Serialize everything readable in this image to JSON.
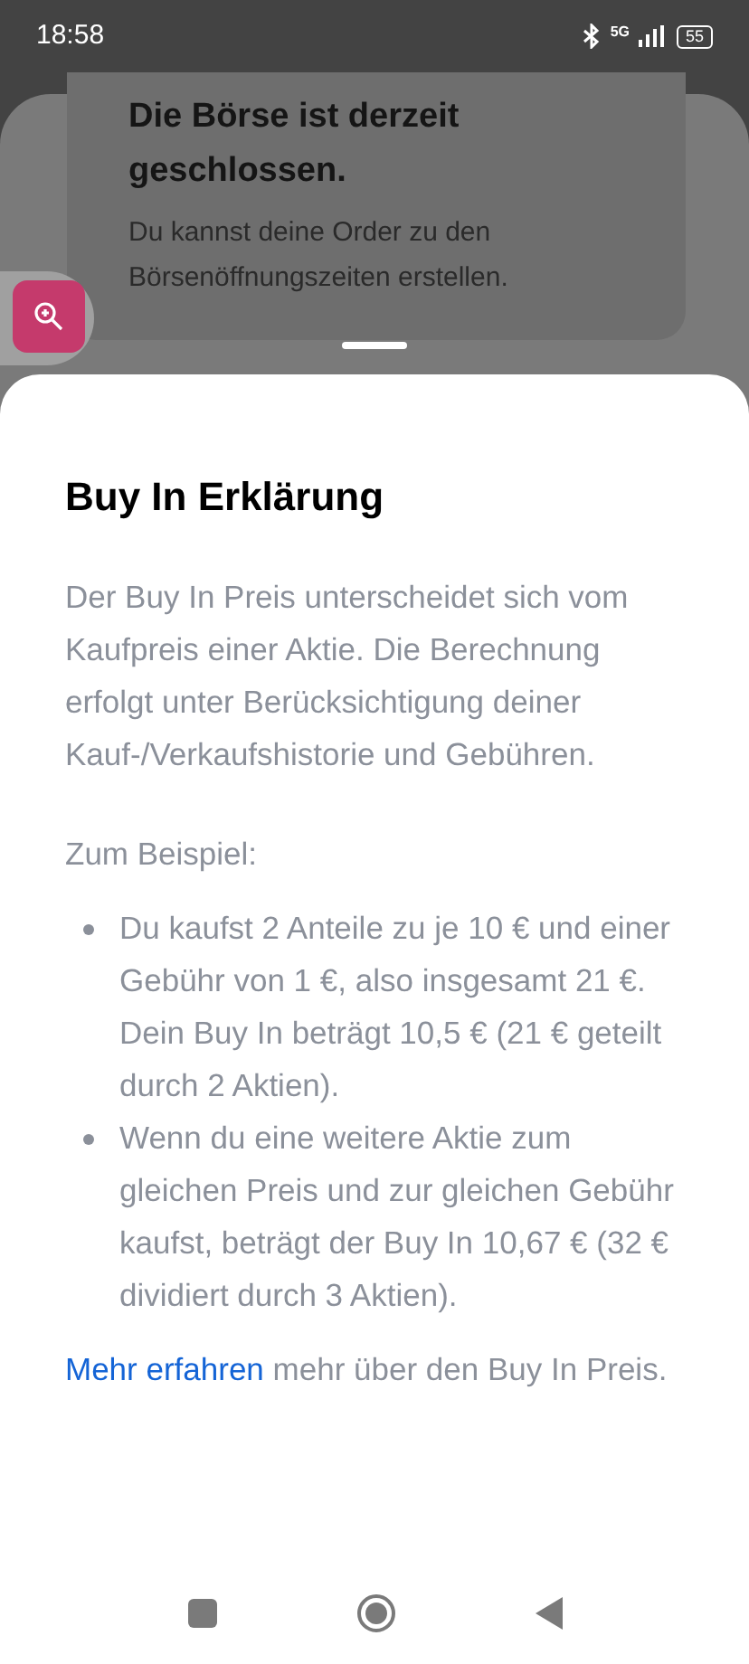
{
  "status_bar": {
    "time": "18:58",
    "network": "5G",
    "battery": "55"
  },
  "background_card": {
    "title": "Die Börse ist derzeit geschlossen.",
    "text": "Du kannst deine Order zu den Börsenöffnungszeiten erstellen."
  },
  "sheet": {
    "title": "Buy In Erklärung",
    "intro": "Der Buy In Preis unterscheidet sich vom Kaufpreis einer Aktie. Die Berechnung erfolgt unter Berücksichtigung deiner Kauf-/Verkaufshistorie und Gebühren.",
    "example_label": "Zum Beispiel:",
    "bullets": [
      "Du kaufst 2 Anteile zu je 10 € und einer Gebühr von 1 €, also insgesamt 21 €. Dein Buy In beträgt 10,5 € (21 € geteilt durch 2 Aktien).",
      "Wenn du eine weitere Aktie zum gleichen Preis und zur gleichen Gebühr kaufst, beträgt der Buy In 10,67 € (32 € dividiert durch 3 Aktien)."
    ],
    "link": "Mehr erfahren",
    "link_rest": "mehr über den Buy In Preis."
  }
}
